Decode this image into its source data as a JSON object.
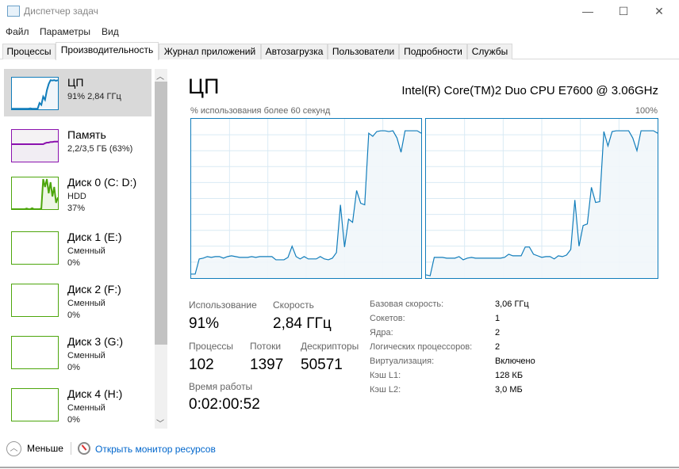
{
  "window": {
    "title": "Диспетчер задач",
    "minimize": "—",
    "maximize": "☐",
    "close": "✕"
  },
  "menu": [
    "Файл",
    "Параметры",
    "Вид"
  ],
  "tabs": [
    "Процессы",
    "Производительность",
    "Журнал приложений",
    "Автозагрузка",
    "Пользователи",
    "Подробности",
    "Службы"
  ],
  "sidebar": [
    {
      "name": "ЦП",
      "line1": "91%  2,84 ГГц",
      "line2": "",
      "color": "#117dbb",
      "spark": [
        2,
        2,
        2,
        2,
        2,
        2,
        2,
        2,
        2,
        2,
        3,
        2,
        2,
        2,
        2,
        20,
        14,
        40,
        30,
        60,
        80,
        92,
        91,
        92,
        90,
        92
      ]
    },
    {
      "name": "Память",
      "line1": "2,2/3,5 ГБ (63%)",
      "line2": "",
      "color": "#8b12ae",
      "spark": [
        55,
        55,
        55,
        55,
        55,
        55,
        55,
        55,
        55,
        55,
        55,
        55,
        55,
        55,
        55,
        55,
        55,
        55,
        58,
        60,
        60,
        62,
        62,
        63,
        63,
        63
      ]
    },
    {
      "name": "Диск 0 (C: D:)",
      "line1": "HDD",
      "line2": "37%",
      "color": "#4da60c",
      "spark": [
        0,
        0,
        0,
        0,
        0,
        0,
        0,
        0,
        2,
        0,
        0,
        3,
        0,
        0,
        0,
        0,
        2,
        95,
        70,
        95,
        50,
        85,
        40,
        70,
        20,
        37
      ]
    },
    {
      "name": "Диск 1 (E:)",
      "line1": "Сменный",
      "line2": "0%",
      "color": "#4da60c",
      "spark": []
    },
    {
      "name": "Диск 2 (F:)",
      "line1": "Сменный",
      "line2": "0%",
      "color": "#4da60c",
      "spark": []
    },
    {
      "name": "Диск 3 (G:)",
      "line1": "Сменный",
      "line2": "0%",
      "color": "#4da60c",
      "spark": []
    },
    {
      "name": "Диск 4 (H:)",
      "line1": "Сменный",
      "line2": "0%",
      "color": "#4da60c",
      "spark": []
    }
  ],
  "main": {
    "title": "ЦП",
    "cpu_name": "Intel(R) Core(TM)2 Duo CPU E7600 @ 3.06GHz",
    "graph_label": "% использования более 60 секунд",
    "graph_max": "100%",
    "cores": [
      [
        2.5,
        2.5,
        12,
        12.5,
        13.5,
        13,
        13.5,
        13.5,
        12.5,
        13.5,
        14,
        13.5,
        13,
        13,
        13,
        13.5,
        13,
        13.5,
        13.5,
        13.5,
        13.5,
        11.5,
        11.5,
        11.5,
        13,
        20,
        13.5,
        12,
        13.5,
        12,
        12,
        12,
        13.5,
        12,
        11.5,
        12.5,
        16,
        46,
        19.5,
        37,
        35,
        55,
        47,
        46,
        91,
        89,
        92,
        92.5,
        92.5,
        92,
        92.5,
        88,
        79,
        92.5,
        92.5,
        92.5,
        92.5,
        91
      ],
      [
        2,
        1.5,
        13,
        13,
        13,
        12.5,
        12.5,
        12.5,
        13.5,
        11.5,
        12.5,
        13,
        12.5,
        12.5,
        12.5,
        12.5,
        12.5,
        12.5,
        12.5,
        13,
        15,
        14,
        14,
        14,
        19.5,
        19.5,
        15,
        14,
        13,
        13.5,
        13.5,
        12,
        14,
        13.5,
        14.5,
        18,
        49,
        20,
        33,
        34,
        57,
        47.5,
        48,
        92,
        83,
        92,
        92.5,
        92.5,
        92.5,
        92.5,
        88,
        80,
        92.5,
        92.5,
        92.5,
        92.5,
        91
      ]
    ],
    "stats": {
      "usage_label": "Использование",
      "usage": "91%",
      "speed_label": "Скорость",
      "speed": "2,84 ГГц",
      "proc_label": "Процессы",
      "proc": "102",
      "threads_label": "Потоки",
      "threads": "1397",
      "handles_label": "Дескрипторы",
      "handles": "50571",
      "uptime_label": "Время работы",
      "uptime": "0:02:00:52"
    },
    "details": [
      [
        "Базовая скорость:",
        "3,06 ГГц"
      ],
      [
        "Сокетов:",
        "1"
      ],
      [
        "Ядра:",
        "2"
      ],
      [
        "Логических процессоров:",
        "2"
      ],
      [
        "Виртуализация:",
        "Включено"
      ],
      [
        "Кэш L1:",
        "128 КБ"
      ],
      [
        "Кэш L2:",
        "3,0 МБ"
      ]
    ]
  },
  "footer": {
    "less": "Меньше",
    "monitor": "Открыть монитор ресурсов"
  }
}
